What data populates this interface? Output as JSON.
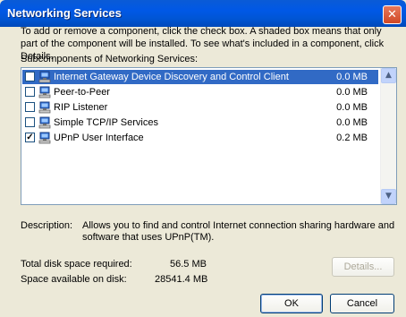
{
  "window": {
    "title": "Networking Services"
  },
  "description_text": "To add or remove a component, click the check box. A shaded box means that only part of the component will be installed. To see what's included in a component, click Details.",
  "subcomponents_label": "Subcomponents of Networking Services:",
  "components": [
    {
      "name": "Internet Gateway Device Discovery and Control Client",
      "size": "0.0 MB",
      "checked": true,
      "selected": true
    },
    {
      "name": "Peer-to-Peer",
      "size": "0.0 MB",
      "checked": false,
      "selected": false
    },
    {
      "name": "RIP Listener",
      "size": "0.0 MB",
      "checked": false,
      "selected": false
    },
    {
      "name": "Simple TCP/IP Services",
      "size": "0.0 MB",
      "checked": false,
      "selected": false
    },
    {
      "name": "UPnP User Interface",
      "size": "0.2 MB",
      "checked": true,
      "selected": false
    }
  ],
  "details": {
    "description_label": "Description:",
    "description_value": "Allows you to find and control Internet connection sharing hardware and software that uses UPnP(TM).",
    "total_required_label": "Total disk space required:",
    "total_required_value": "56.5 MB",
    "available_label": "Space available on disk:",
    "available_value": "28541.4 MB"
  },
  "buttons": {
    "details": "Details...",
    "ok": "OK",
    "cancel": "Cancel"
  },
  "icons": {
    "close": "close-icon",
    "component": "network-computer-icon",
    "scroll_up": "arrow-up-icon",
    "scroll_down": "arrow-down-icon"
  }
}
